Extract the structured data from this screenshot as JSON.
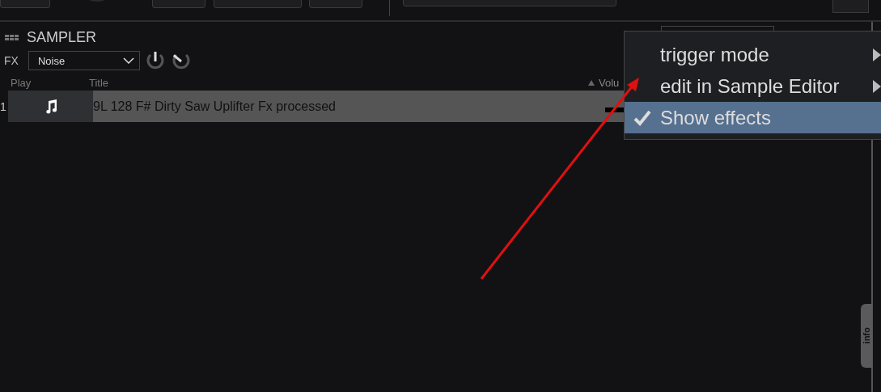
{
  "panel": {
    "title": "SAMPLER"
  },
  "fx": {
    "label": "FX",
    "value": "Noise"
  },
  "table": {
    "columns": [
      {
        "label": "Play"
      },
      {
        "label": "Title"
      },
      {
        "label": "Volu",
        "sorted": true
      }
    ],
    "rows": [
      {
        "number": "1",
        "title": "9L 128 F# Dirty Saw Uplifter Fx processed",
        "selected": true
      }
    ]
  },
  "menu": [
    {
      "label": "trigger mode",
      "submenu": true,
      "checked": false,
      "selected": false
    },
    {
      "label": "edit in Sample Editor",
      "submenu": true,
      "checked": false,
      "selected": false
    },
    {
      "label": "Show effects",
      "submenu": false,
      "checked": true,
      "selected": true
    }
  ],
  "info_tab": {
    "label": "info"
  }
}
